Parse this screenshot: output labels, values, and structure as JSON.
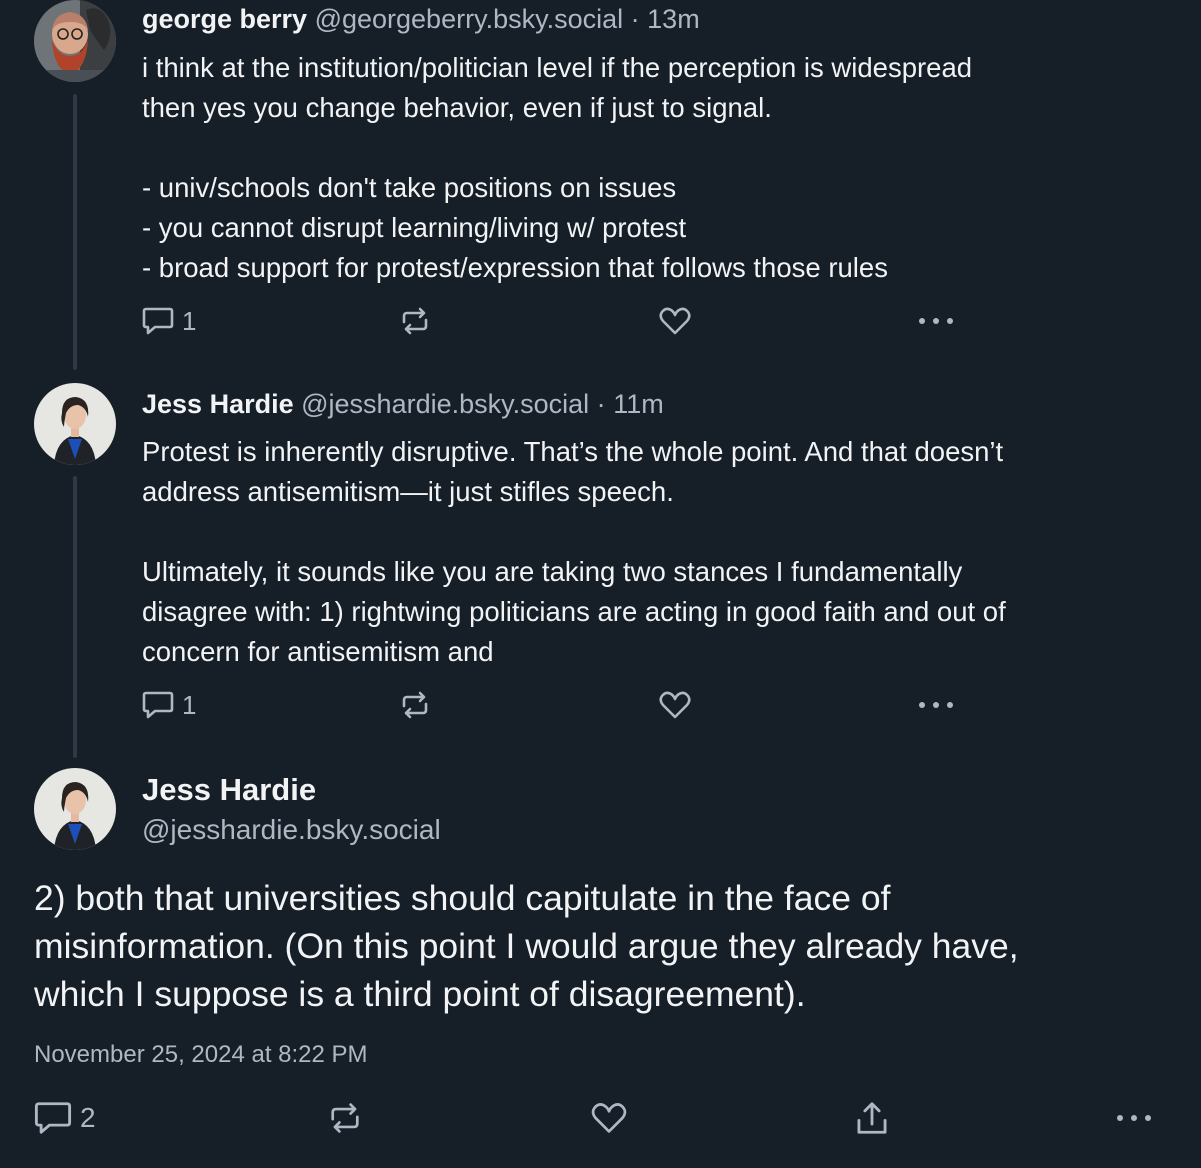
{
  "posts": [
    {
      "author_name": "george berry",
      "handle": "@georgeberry.bsky.social",
      "separator": "·",
      "time": "13m",
      "lines": [
        "i think at the institution/politician level if the perception is widespread",
        "then yes you change behavior, even if just to signal.",
        "",
        "- univ/schools don't take positions on issues",
        "- you cannot disrupt learning/living w/ protest",
        "- broad support for protest/expression that follows those rules"
      ],
      "reply_count": "1",
      "avatar_icon": "bearded-man-avatar"
    },
    {
      "author_name": "Jess Hardie",
      "handle": "@jesshardie.bsky.social",
      "separator": "·",
      "time": "11m",
      "lines": [
        "Protest is inherently disruptive. That’s the whole point. And that doesn’t",
        "address antisemitism—it just stifles speech.",
        "",
        "Ultimately, it sounds like you are taking two stances I fundamentally",
        "disagree with: 1) rightwing politicians are acting in good faith and out of",
        "concern for antisemitism and"
      ],
      "reply_count": "1",
      "avatar_icon": "woman-portrait-avatar"
    }
  ],
  "focused_post": {
    "author_name": "Jess Hardie",
    "handle": "@jesshardie.bsky.social",
    "lines": [
      "2) both that universities should capitulate in the face of",
      "misinformation. (On this point I would argue they already have,",
      "which I suppose is a third point of disagreement)."
    ],
    "date": "November 25, 2024 at 8:22 PM",
    "reply_count": "2",
    "avatar_icon": "woman-portrait-avatar"
  },
  "icons": {
    "reply": "speech-bubble-icon",
    "repost": "repost-arrows-icon",
    "like": "heart-icon",
    "share": "share-icon",
    "more": "more-dots-icon"
  },
  "colors": {
    "background": "#161e27",
    "text": "#f1f3f5",
    "muted": "#aeb8c4",
    "thread_line": "#2e3945"
  }
}
